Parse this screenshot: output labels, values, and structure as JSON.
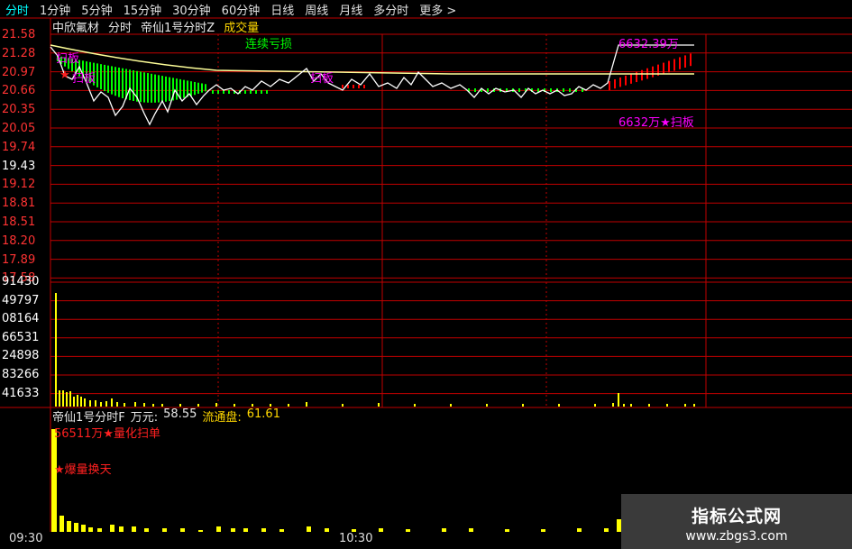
{
  "tabs": [
    {
      "label": "分时",
      "active": true
    },
    {
      "label": "1分钟"
    },
    {
      "label": "5分钟"
    },
    {
      "label": "15分钟"
    },
    {
      "label": "30分钟"
    },
    {
      "label": "60分钟"
    },
    {
      "label": "日线"
    },
    {
      "label": "周线"
    },
    {
      "label": "月线"
    },
    {
      "label": "多分时"
    },
    {
      "label": "更多 >"
    }
  ],
  "header": {
    "stock_name": "中欣氟材",
    "chart_mode": "分时",
    "indicator": "帝仙1号分时Z",
    "volume_label": "成交量",
    "signal_text": "连续亏损"
  },
  "price_axis": [
    "21.58",
    "21.28",
    "20.97",
    "20.66",
    "20.35",
    "20.05",
    "19.74",
    "19.43",
    "19.12",
    "18.81",
    "18.51",
    "18.20",
    "17.89",
    "17.58"
  ],
  "volume_axis": [
    "91430",
    "49797",
    "08164",
    "66531",
    "24898",
    "83266",
    "41633"
  ],
  "annotations": {
    "price_tag": "6632.39万",
    "scan_board": "6632万★扫板",
    "left_tag_top": "扫板",
    "left_star": "★",
    "left_tag_mid": "扫板",
    "mid_tag": "扫板"
  },
  "sub_chart": {
    "name": "帝仙1号分时F",
    "wan_label": "万元:",
    "wan_value": "58.55",
    "float_label": "流通盘:",
    "float_value": "61.61",
    "quant_scan": "56511万★量化扫单",
    "burst": "★爆量换天"
  },
  "time_axis": [
    "09:30",
    "10:30"
  ],
  "watermark": {
    "line1": "指标公式网",
    "line2": "www.zbgs3.com"
  },
  "colors": {
    "grid": "#c00000",
    "price_line": "#ffffff",
    "avg_line": "#ffff99",
    "volume_bar": "#ffff00",
    "up_tick": "#00ff00",
    "down_tick": "#ff0000"
  }
}
